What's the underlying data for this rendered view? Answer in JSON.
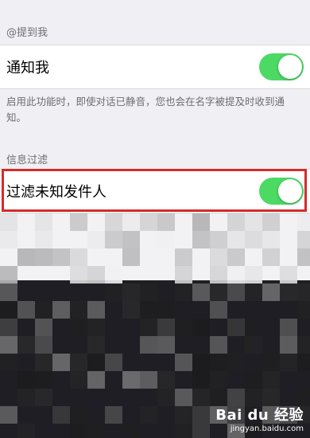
{
  "mention_section": {
    "header": "@提到我",
    "notify_row": {
      "label": "通知我",
      "toggle_on": true
    },
    "footer": "启用此功能时，即使对话已静音，您也会在名字被提及时收到通知。"
  },
  "filter_section": {
    "header": "信息过滤",
    "filter_row": {
      "label": "过滤未知发件人",
      "toggle_on": true
    }
  },
  "colors": {
    "toggle_on": "#4cd964",
    "highlight": "#d52b2b",
    "background": "#efeff4"
  },
  "watermark": {
    "brand": "Bai du 经验",
    "url": "jingyan.baidu.com"
  }
}
